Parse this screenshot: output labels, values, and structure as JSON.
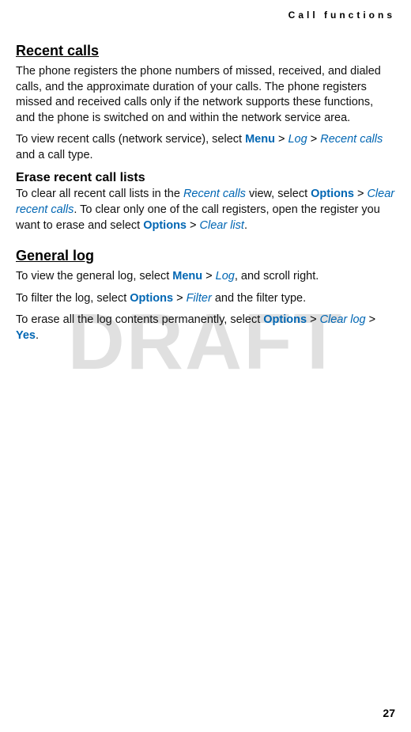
{
  "header": {
    "running": "Call functions"
  },
  "page": {
    "number": "27"
  },
  "watermark": "DRAFT",
  "sections": {
    "recent_calls": {
      "title": "Recent calls",
      "p1": "The phone registers the phone numbers of missed, received, and dialed calls, and the approximate duration of your calls. The phone registers missed and received calls only if the network supports these functions, and the phone is switched on and within the network service area.",
      "p2_a": "To view recent calls (network service), select ",
      "menu": "Menu",
      "gt1": " > ",
      "log": "Log",
      "gt2": " > ",
      "recent_calls_item": "Recent calls",
      "p2_b": " and a call type."
    },
    "erase": {
      "title": "Erase recent call lists",
      "p1_a": "To clear all recent call lists in the ",
      "recent_calls_view": "Recent calls",
      "p1_b": " view, select ",
      "options1": "Options",
      "gt1": " > ",
      "clear_recent": "Clear recent calls",
      "p1_c": ". To clear only one of the call registers, open the register you want to erase and select ",
      "options2": "Options",
      "gt2": " > ",
      "clear_list": "Clear list",
      "p1_d": "."
    },
    "general_log": {
      "title": "General log",
      "p1_a": "To view the general log, select ",
      "menu": "Menu",
      "gt1": " > ",
      "log": "Log",
      "p1_b": ", and scroll right.",
      "p2_a": "To filter the log, select ",
      "options1": "Options",
      "gt2": " > ",
      "filter": "Filter",
      "p2_b": " and the filter type.",
      "p3_a": "To erase all the log contents permanently, select ",
      "options2": "Options",
      "gt3": " > ",
      "clear_log": "Clear log",
      "gt4": " > ",
      "yes": "Yes",
      "p3_b": "."
    }
  }
}
